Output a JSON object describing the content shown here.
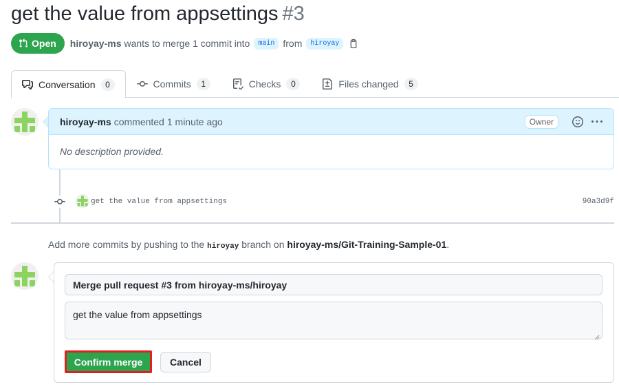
{
  "pr": {
    "title": "get the value from appsettings",
    "number": "#3",
    "state": "Open",
    "author": "hiroyay-ms",
    "wants_text": "wants to merge 1 commit into",
    "base_branch": "main",
    "from_text": "from",
    "head_branch": "hiroyay"
  },
  "tabs": [
    {
      "label": "Conversation",
      "count": "0",
      "icon": "comment-discussion-icon"
    },
    {
      "label": "Commits",
      "count": "1",
      "icon": "git-commit-icon"
    },
    {
      "label": "Checks",
      "count": "0",
      "icon": "checklist-icon"
    },
    {
      "label": "Files changed",
      "count": "5",
      "icon": "file-diff-icon"
    }
  ],
  "comment": {
    "author": "hiroyay-ms",
    "action": "commented",
    "time": "1 minute ago",
    "role_badge": "Owner",
    "body": "No description provided."
  },
  "commit": {
    "message": "get the value from appsettings",
    "sha": "90a3d9f"
  },
  "push_hint": {
    "prefix": "Add more commits by pushing to the",
    "branch": "hiroyay",
    "middle": "branch on",
    "repo": "hiroyay-ms/Git-Training-Sample-01",
    "suffix": "."
  },
  "merge": {
    "title_value": "Merge pull request #3 from hiroyay-ms/hiroyay",
    "body_value": "get the value from appsettings",
    "confirm_label": "Confirm merge",
    "cancel_label": "Cancel"
  },
  "colors": {
    "open_green": "#2da44e",
    "highlight_red": "#e02020",
    "link_blue": "#0969da"
  }
}
